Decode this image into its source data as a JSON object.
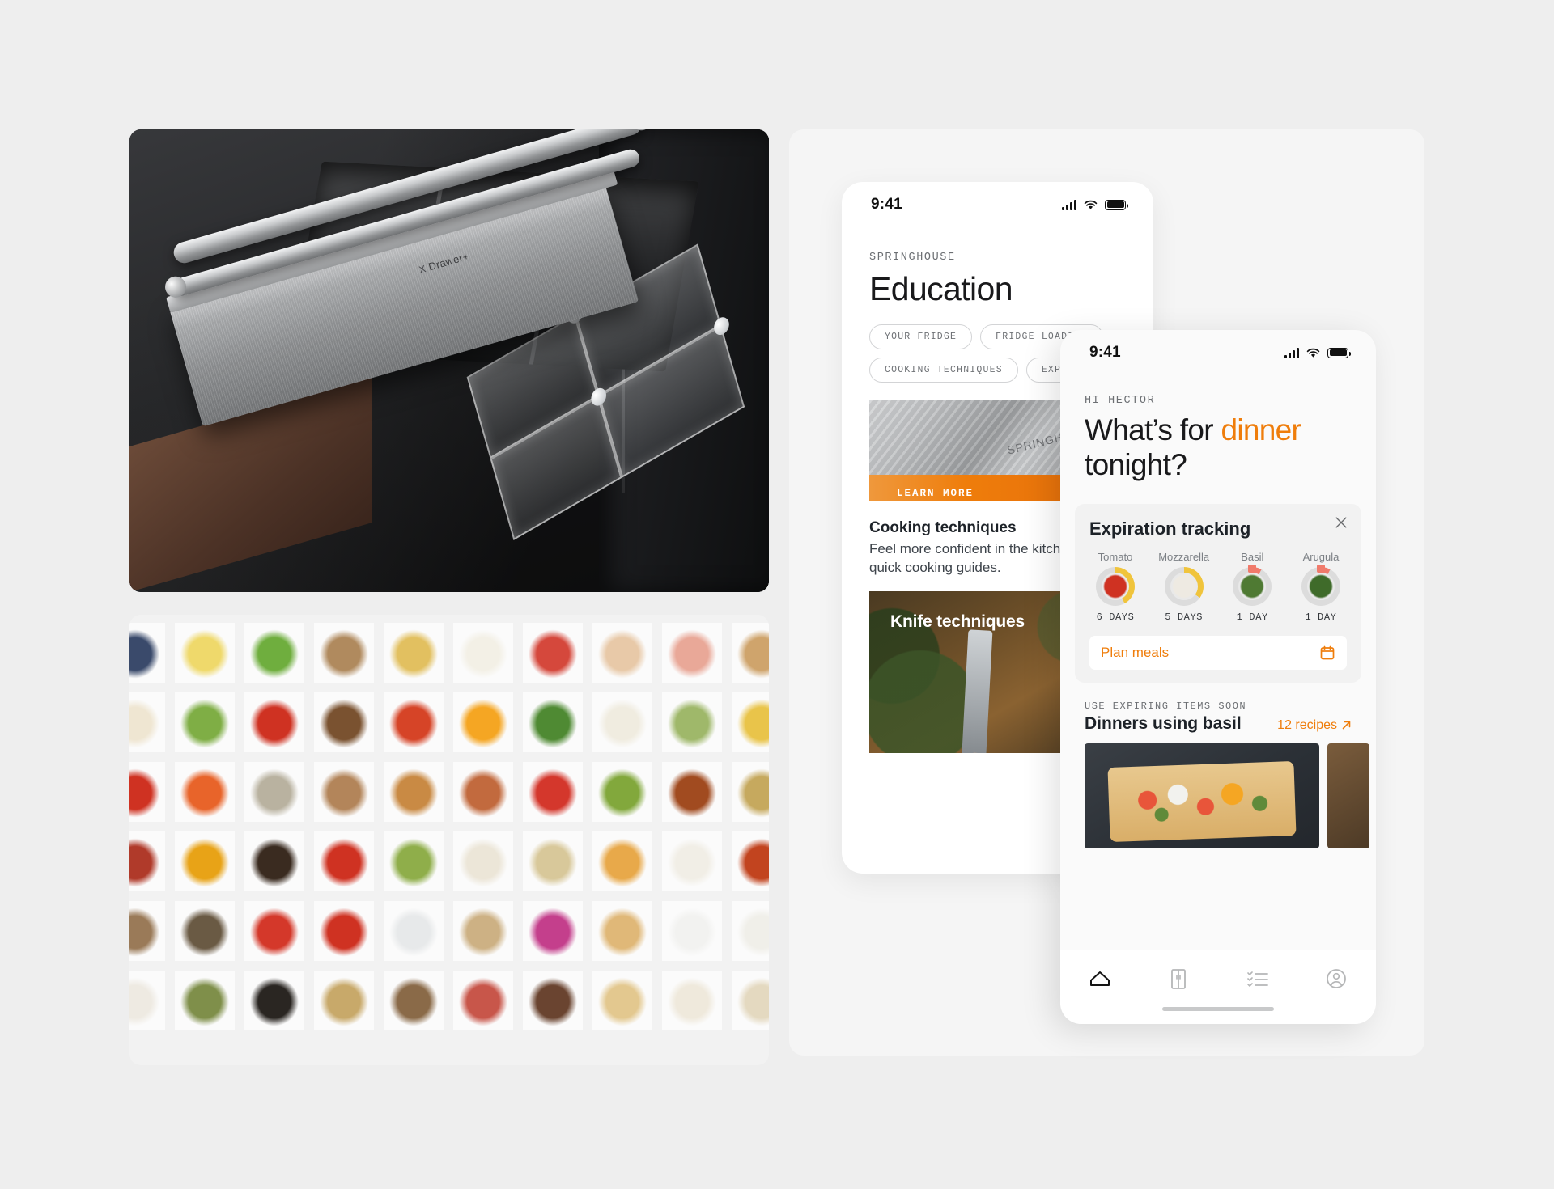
{
  "hero": {
    "product_badge": "Drawer+",
    "badge_mark": "X"
  },
  "phone_education": {
    "status_bar": {
      "time": "9:41",
      "signal_icon": "cellular-signal-icon",
      "wifi_icon": "wifi-icon",
      "battery_icon": "battery-icon"
    },
    "eyebrow": "SPRINGHOUSE",
    "title": "Education",
    "chips": [
      "YOUR FRIDGE",
      "FRIDGE LOADING",
      "COOKING TECHNIQUES",
      "EXPIRATION"
    ],
    "promo": {
      "logo_text": "SPRINGHOUSE",
      "cta_label": "LEARN MORE"
    },
    "section": {
      "title": "Cooking techniques",
      "body": "Feel more confident in the kitchen with quick cooking guides."
    },
    "knife_card": {
      "label": "Knife techniques"
    }
  },
  "phone_dinner": {
    "status_bar": {
      "time": "9:41",
      "signal_icon": "cellular-signal-icon",
      "wifi_icon": "wifi-icon",
      "battery_icon": "battery-icon"
    },
    "greeting": "HI HECTOR",
    "title_part1": "What’s for ",
    "title_accent": "dinner",
    "title_part2": " tonight?",
    "expiration": {
      "heading": "Expiration tracking",
      "close_icon": "close-icon",
      "items": [
        {
          "name": "Tomato",
          "days": "6 DAYS",
          "progress": 0.42,
          "urgent": false,
          "ring_color": "#f0c43c",
          "swatch": "#cf3222"
        },
        {
          "name": "Mozzarella",
          "days": "5 DAYS",
          "progress": 0.35,
          "urgent": false,
          "ring_color": "#f0c43c",
          "swatch": "#eeeae2"
        },
        {
          "name": "Basil",
          "days": "1 DAY",
          "progress": 0.08,
          "urgent": true,
          "ring_color": "#f07a6b",
          "swatch": "#4f7a33"
        },
        {
          "name": "Arugula",
          "days": "1 DAY",
          "progress": 0.08,
          "urgent": true,
          "ring_color": "#f07a6b",
          "swatch": "#3f6b2a"
        }
      ],
      "plan_label": "Plan meals",
      "plan_icon": "calendar-icon"
    },
    "recipes": {
      "eyebrow": "USE EXPIRING ITEMS SOON",
      "heading": "Dinners using basil",
      "link_label": "12 recipes",
      "link_icon": "arrow-up-right-icon"
    },
    "tabs": [
      {
        "name": "home",
        "icon": "home-icon",
        "active": true
      },
      {
        "name": "fridge",
        "icon": "fridge-icon",
        "active": false
      },
      {
        "name": "list",
        "icon": "checklist-icon",
        "active": false
      },
      {
        "name": "profile",
        "icon": "profile-icon",
        "active": false
      }
    ]
  },
  "colors": {
    "accent_orange": "#ef7d0b",
    "page_bg": "#eeeeee",
    "panel_bg": "#f5f5f5",
    "urgent_red": "#f07a6b",
    "warn_yellow": "#f0c43c"
  },
  "food_grid": {
    "rows": [
      [
        "#3a4a6b",
        "#efd96b",
        "#6fae3e",
        "#b08a5e",
        "#e2c060",
        "#f3f0e6",
        "#d5483c",
        "#e8c9a8",
        "#e9a898",
        "#cfa46c",
        "#d8cbb6"
      ],
      [
        "#efe6d2",
        "#7fae45",
        "#cf3222",
        "#7a5230",
        "#d64427",
        "#f5a623",
        "#4f8a33",
        "#f0ece0",
        "#9fb86a",
        "#e9c44a",
        "#e3dcc8"
      ],
      [
        "#cf3222",
        "#e8642a",
        "#b9b2a0",
        "#b3855a",
        "#c98a44",
        "#c26a3e",
        "#d4372c",
        "#82a83c",
        "#a14b20",
        "#c6a95e",
        "#d9c9a6"
      ],
      [
        "#b03a2a",
        "#e8a317",
        "#3a2b20",
        "#cf3222",
        "#8fae4a",
        "#ece6d8",
        "#d8c89a",
        "#e8a94a",
        "#f1eee6",
        "#c2441f",
        "#ddd2bd"
      ],
      [
        "#9a7a58",
        "#6a5a44",
        "#d4382a",
        "#cf3222",
        "#e7e9ea",
        "#cdb184",
        "#c43f8c",
        "#e0b878",
        "#f2f2f0",
        "#f0efe9",
        "#dedacf"
      ],
      [
        "#eeeae2",
        "#7f8f4a",
        "#2a2622",
        "#c8a96a",
        "#8a6a48",
        "#c8564a",
        "#6a4430",
        "#e3c88f",
        "#efe9dc",
        "#e4d9c0",
        "#d9cdb4"
      ]
    ]
  }
}
